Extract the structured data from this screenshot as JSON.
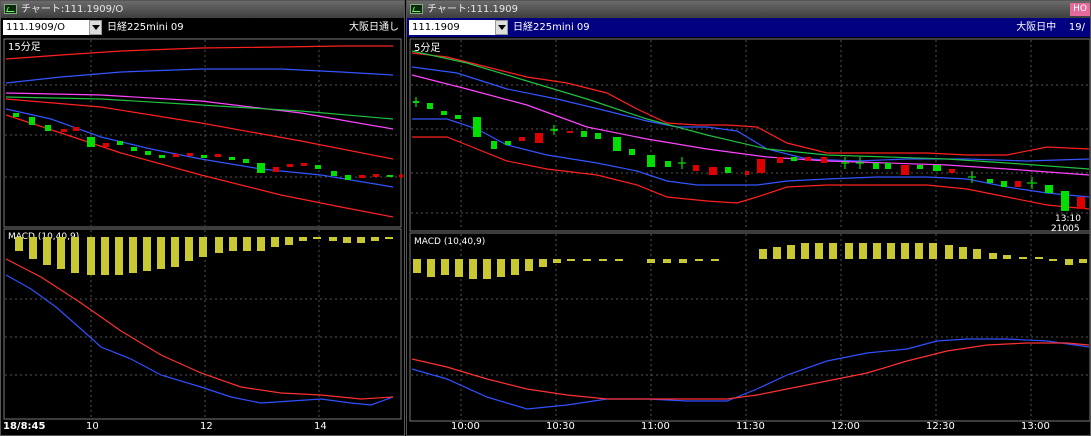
{
  "left": {
    "title": "チャート:111.1909/O",
    "symbol": "111.1909/O",
    "instrument": "日経225mini 09",
    "session": "大阪日通し",
    "timeframe": "15分足",
    "macd_label": "MACD (10,40,9)",
    "start_date": "18/8:45",
    "x_ticks": [
      "10",
      "12",
      "14"
    ]
  },
  "right": {
    "title": "チャート:111.1909",
    "symbol": "111.1909",
    "instrument": "日経225mini 09",
    "session": "大阪日中",
    "session_extra": "19/",
    "corner_tag": "HO",
    "timeframe": "5分足",
    "macd_label": "MACD (10,40,9)",
    "last_time": "13:10",
    "last_price": "21005",
    "x_ticks": [
      "10:00",
      "10:30",
      "11:00",
      "11:30",
      "12:00",
      "12:30",
      "13:00"
    ]
  },
  "colors": {
    "up": "#00e000",
    "down": "#e00000",
    "macd_bar": "#c8c832",
    "macd_line": "#3050ff",
    "signal_line": "#ff3030",
    "grid": "#555555"
  }
}
